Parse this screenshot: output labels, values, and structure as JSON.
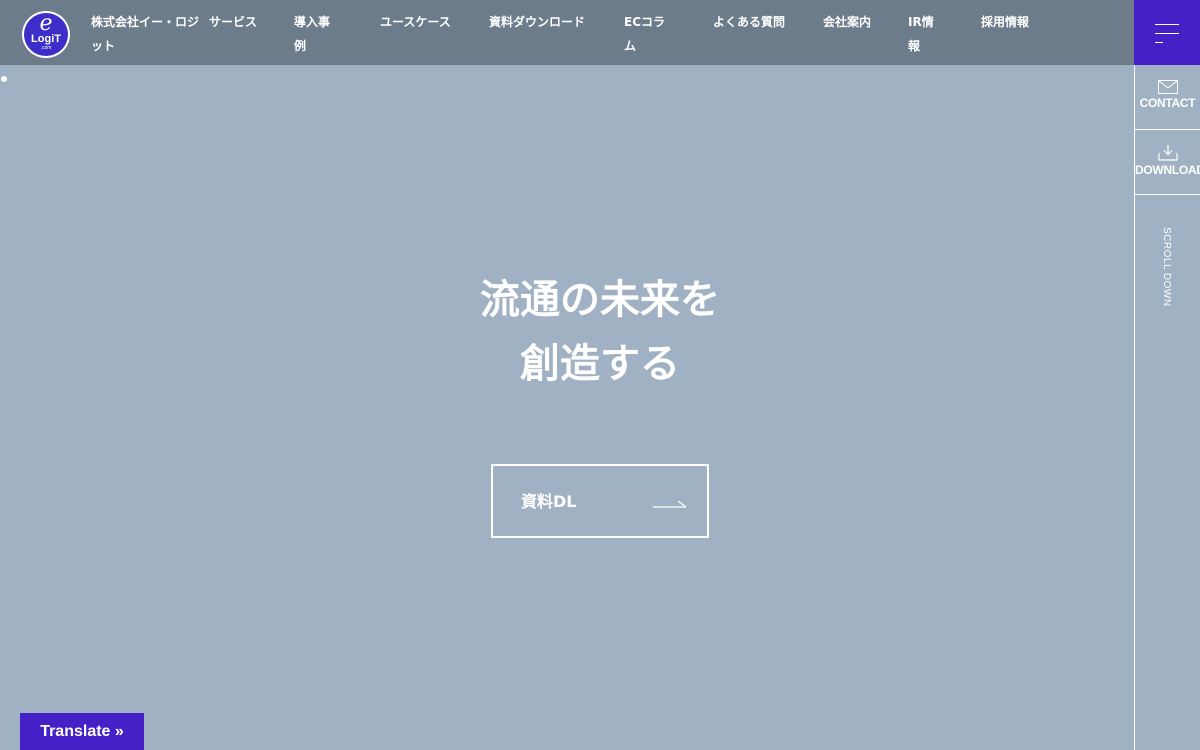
{
  "logo": {
    "mark": "e",
    "wordmark": "LogiT",
    "suffix": ".com"
  },
  "header": {
    "company": "株式会社イー・ロジット",
    "nav": [
      {
        "name": "nav-services",
        "label": "サービス"
      },
      {
        "name": "nav-case-studies",
        "label": "導入事例"
      },
      {
        "name": "nav-use-cases",
        "label": "ユースケース"
      },
      {
        "name": "nav-downloads",
        "label": "資料ダウンロード"
      },
      {
        "name": "nav-ec-column",
        "label": "ECコラム"
      },
      {
        "name": "nav-faq",
        "label": "よくある質問"
      },
      {
        "name": "nav-company",
        "label": "会社案内"
      },
      {
        "name": "nav-ir",
        "label": "IR情報"
      },
      {
        "name": "nav-recruit",
        "label": "採用情報"
      }
    ]
  },
  "menu": {
    "icon": "hamburger-icon"
  },
  "sidebar": {
    "contact_label": "CONTACT",
    "contact_icon": "mail-icon",
    "download_label": "DOWNLOAD",
    "download_icon": "download-icon",
    "scroll_label": "SCROLL DOWN"
  },
  "hero": {
    "title_line1": "流通の未来を",
    "title_line2": "創造する",
    "cta_label": "資料DL",
    "cta_icon": "arrow-right-icon"
  },
  "translate": {
    "label": "Translate »"
  },
  "colors": {
    "header_bg": "#6c7c8a",
    "hero_bg": "#9fb1c2",
    "accent": "#4420c7"
  }
}
